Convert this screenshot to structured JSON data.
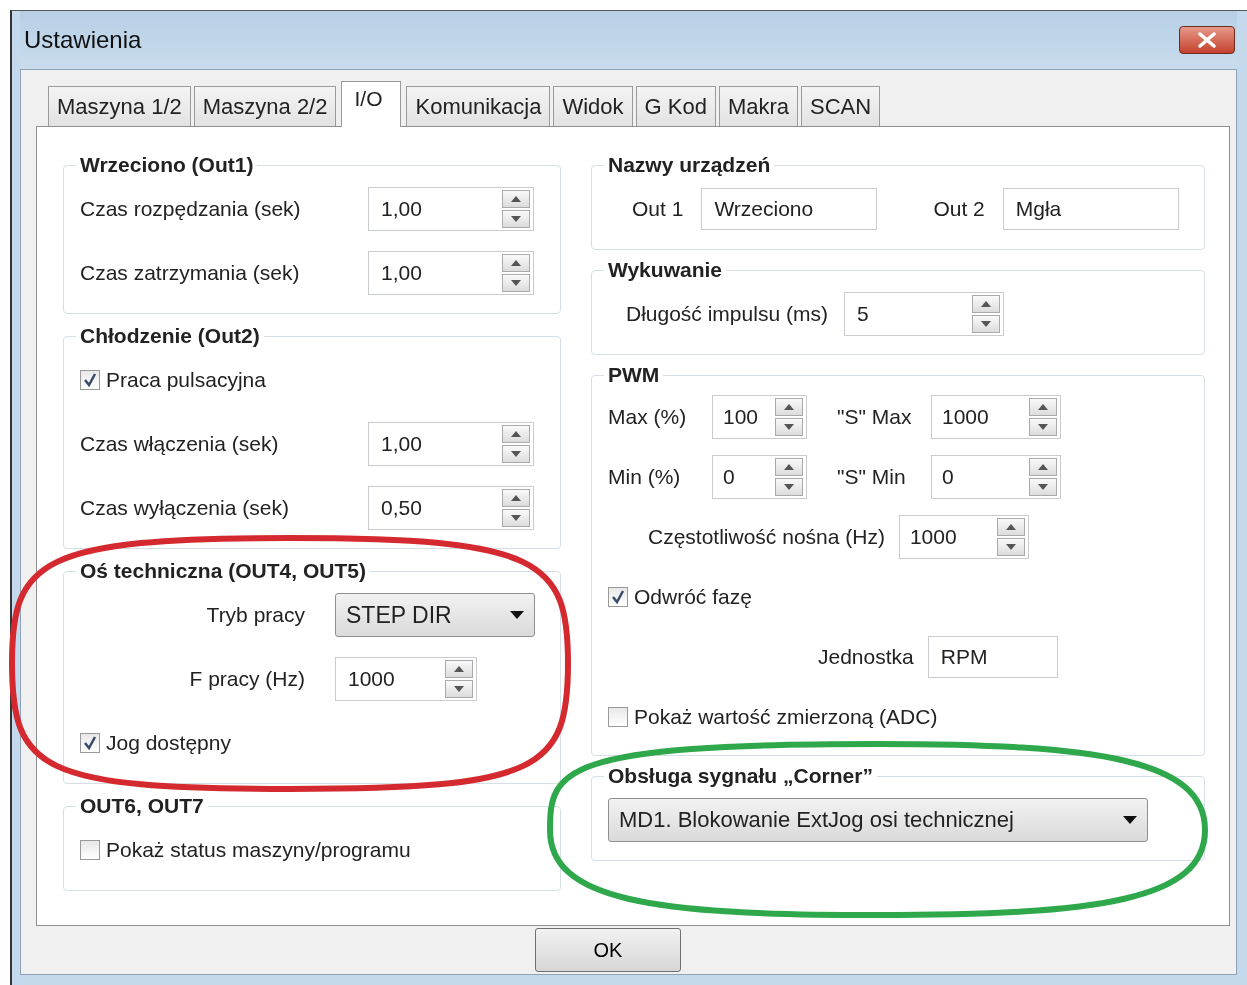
{
  "window": {
    "title": "Ustawienia"
  },
  "tabs": [
    {
      "label": "Maszyna 1/2",
      "selected": false
    },
    {
      "label": "Maszyna 2/2",
      "selected": false
    },
    {
      "label": "I/O",
      "selected": true
    },
    {
      "label": "Komunikacja",
      "selected": false
    },
    {
      "label": "Widok",
      "selected": false
    },
    {
      "label": "G Kod",
      "selected": false
    },
    {
      "label": "Makra",
      "selected": false
    },
    {
      "label": "SCAN",
      "selected": false
    }
  ],
  "left_groups": [
    {
      "title": "Wrzeciono (Out1)",
      "rows": [
        [
          {
            "kind": "spin",
            "label": "Czas rozpędzania (sek)",
            "value": "1,00"
          }
        ],
        [
          {
            "kind": "spin",
            "label": "Czas zatrzymania (sek)",
            "value": "1,00"
          }
        ]
      ]
    },
    {
      "title": "Chłodzenie (Out2)",
      "rows": [
        [
          {
            "kind": "checkbox",
            "label": "Praca pulsacyjna",
            "checked": true
          }
        ],
        [
          {
            "kind": "spin",
            "label": "Czas włączenia (sek)",
            "value": "1,00"
          }
        ],
        [
          {
            "kind": "spin",
            "label": "Czas wyłączenia (sek)",
            "value": "0,50"
          }
        ]
      ]
    },
    {
      "title": "Oś techniczna (OUT4, OUT5)",
      "rows": [
        [
          {
            "kind": "dropdown",
            "label": "Tryb pracy",
            "value": "STEP DIR"
          }
        ],
        [
          {
            "kind": "spin",
            "label": "F pracy (Hz)",
            "value": "1000"
          }
        ],
        [
          {
            "kind": "checkbox",
            "label": "Jog dostępny",
            "checked": true
          }
        ]
      ]
    },
    {
      "title": "OUT6, OUT7",
      "rows": [
        [
          {
            "kind": "checkbox",
            "label": "Pokaż status maszyny/programu",
            "checked": false
          }
        ]
      ]
    }
  ],
  "right_groups": [
    {
      "title": "Nazwy urządzeń",
      "rows": [
        [
          {
            "kind": "field",
            "label": "Out 1",
            "value": "Wrzeciono"
          },
          {
            "kind": "field",
            "label": "Out 2",
            "value": "Mgła"
          }
        ]
      ]
    },
    {
      "title": "Wykuwanie",
      "rows": [
        [
          {
            "kind": "spin",
            "label": "Długość impulsu (ms)",
            "value": "5"
          }
        ]
      ]
    },
    {
      "title": "PWM",
      "rows": [
        [
          {
            "kind": "spin",
            "label": "Max (%)",
            "value": "100"
          },
          {
            "kind": "spin",
            "label": "\"S\" Max",
            "value": "1000"
          }
        ],
        [
          {
            "kind": "spin",
            "label": "Min (%)",
            "value": "0"
          },
          {
            "kind": "spin",
            "label": "\"S\" Min",
            "value": "0"
          }
        ],
        [
          {
            "kind": "spin",
            "label": "Częstotliwość nośna (Hz)",
            "value": "1000"
          }
        ],
        [
          {
            "kind": "checkbox",
            "label": "Odwróć fazę",
            "checked": true
          }
        ],
        [
          {
            "kind": "field",
            "label": "Jednostka",
            "value": "RPM"
          }
        ],
        [
          {
            "kind": "checkbox",
            "label": "Pokaż wartość zmierzoną (ADC)",
            "checked": false
          }
        ]
      ]
    },
    {
      "title": "Obsługa sygnału „Corner”",
      "rows": [
        [
          {
            "kind": "dropdown",
            "value": "MD1. Blokowanie ExtJog osi technicznej"
          }
        ]
      ]
    }
  ],
  "ok_button": "OK",
  "annotations": [
    {
      "color": "#d42a2f"
    },
    {
      "color": "#2fa84b"
    }
  ]
}
